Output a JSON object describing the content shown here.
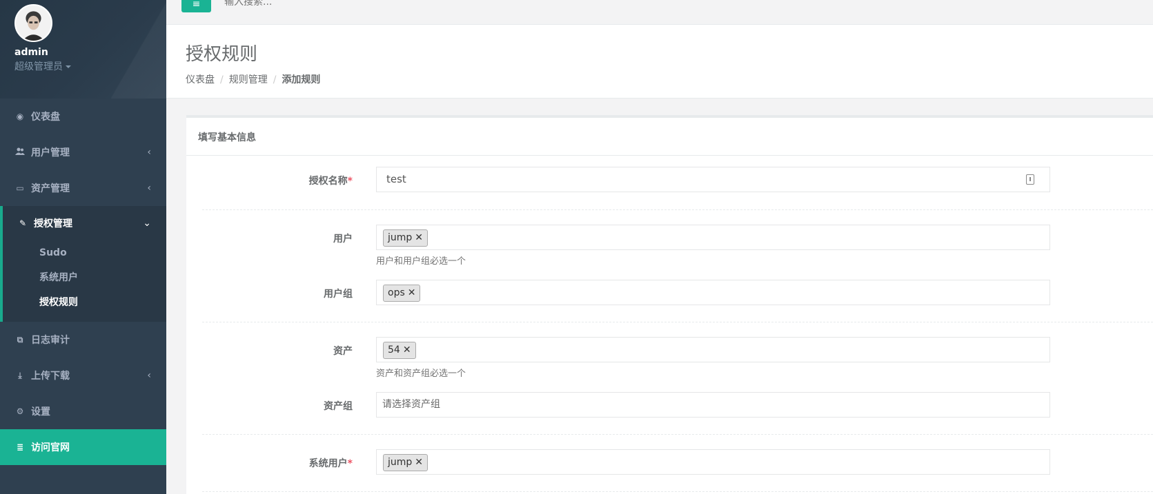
{
  "profile": {
    "name": "admin",
    "role": "超级管理员"
  },
  "nav": [
    {
      "label": "仪表盘",
      "icon": "dashboard-icon",
      "glyph": "◉"
    },
    {
      "label": "用户管理",
      "icon": "users-icon",
      "glyph": "👥",
      "arrow": "‹"
    },
    {
      "label": "资产管理",
      "icon": "inbox-icon",
      "glyph": "▭",
      "arrow": "‹"
    },
    {
      "label": "授权管理",
      "icon": "edit-icon",
      "glyph": "✎",
      "arrow": "⌄",
      "children": [
        "Sudo",
        "系统用户",
        "授权规则"
      ]
    },
    {
      "label": "日志审计",
      "icon": "copy-icon",
      "glyph": "⧉"
    },
    {
      "label": "上传下载",
      "icon": "download-icon",
      "glyph": "⤓",
      "arrow": "‹"
    },
    {
      "label": "设置",
      "icon": "gears-icon",
      "glyph": "⚙"
    },
    {
      "label": "访问官网",
      "icon": "database-icon",
      "glyph": "≣"
    }
  ],
  "topbar": {
    "menu_glyph": "≡",
    "search_placeholder": "输入搜索..."
  },
  "heading": {
    "title": "授权规则",
    "breadcrumb": [
      "仪表盘",
      "规则管理",
      "添加规则"
    ]
  },
  "panel": {
    "title": "填写基本信息"
  },
  "form": {
    "name": {
      "label": "授权名称",
      "required": "*",
      "value": "test"
    },
    "user": {
      "label": "用户",
      "tag": "jump",
      "help": "用户和用户组必选一个"
    },
    "user_group": {
      "label": "用户组",
      "tag": "ops"
    },
    "asset": {
      "label": "资产",
      "tag": "54",
      "help": "资产和资产组必选一个"
    },
    "asset_group": {
      "label": "资产组",
      "placeholder": "请选择资产组"
    },
    "system_user": {
      "label": "系统用户",
      "required": "*",
      "tag": "jump"
    },
    "tag_remove": "✕"
  },
  "colors": {
    "sidebar": "#2f4050",
    "accent": "#1ab394",
    "required": "#ed5565"
  }
}
